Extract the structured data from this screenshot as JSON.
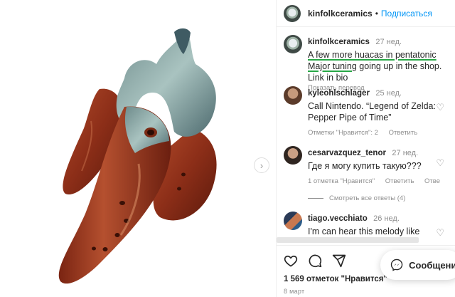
{
  "post": {
    "author": "kinfolkceramics",
    "follow_label": "Подписаться",
    "separator": "•"
  },
  "caption": {
    "user": "kinfolkceramics",
    "time": "27 нед.",
    "text_underlined": "A few more huacas in pentatonic Major tuning",
    "text_rest": " going up in the shop. Link in bio",
    "translate": "Показать перевод"
  },
  "comments": [
    {
      "user": "kyleohlschlager",
      "time": "25 нед.",
      "text": "Call Nintendo. “Legend of Zelda: Pepper Pipe of Time”",
      "likes_label": "Отметки \"Нравится\": 2",
      "reply_label": "Ответить"
    },
    {
      "user": "cesarvazquez_tenor",
      "time": "27 нед.",
      "text": "Где я могу купить такую???",
      "likes_label": "1 отметка \"Нравится\"",
      "reply_label": "Ответить",
      "extra_label": "Отве"
    },
    {
      "user": "tiago.vecchiato",
      "time": "26 нед.",
      "text": "I'm can hear this melody like"
    }
  ],
  "view_replies": "Смотреть все ответы (4)",
  "footer": {
    "likes": "1 569 отметок \"Нравится\"",
    "date": "8 март"
  },
  "messages_button": "Сообщения",
  "icons": [
    "heart-icon",
    "comment-icon",
    "share-icon",
    "messenger-icon",
    "chevron-right-icon"
  ]
}
